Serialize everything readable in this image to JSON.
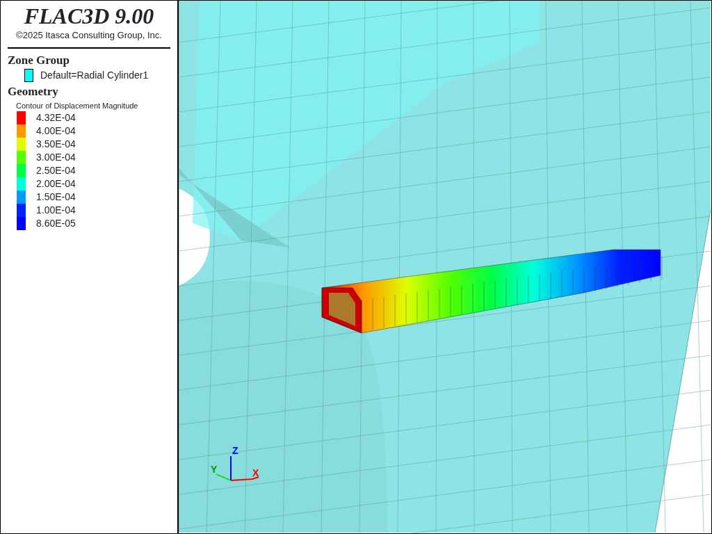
{
  "legend": {
    "title": "FLAC3D 9.00",
    "copyright": "©2025 Itasca Consulting Group, Inc.",
    "zone_group": {
      "heading": "Zone Group",
      "items": [
        {
          "label": "Default=Radial Cylinder1",
          "color": "#00ffff"
        }
      ]
    },
    "geometry": {
      "heading": "Geometry",
      "contour_title": "Contour of Displacement Magnitude",
      "entries": [
        {
          "label": "4.32E-04",
          "color": "#ff0000"
        },
        {
          "label": "4.00E-04",
          "color": "#ff9900"
        },
        {
          "label": "3.50E-04",
          "color": "#ddff00"
        },
        {
          "label": "3.00E-04",
          "color": "#55ff00"
        },
        {
          "label": "2.50E-04",
          "color": "#00ff44"
        },
        {
          "label": "2.00E-04",
          "color": "#00ffdd"
        },
        {
          "label": "1.50E-04",
          "color": "#0099ff"
        },
        {
          "label": "1.00E-04",
          "color": "#0022ff"
        },
        {
          "label": "8.60E-05",
          "color": "#0000ff"
        }
      ]
    }
  },
  "axes": [
    {
      "label": "Z",
      "color": "#0000ff"
    },
    {
      "label": "Y",
      "color": "#009900"
    },
    {
      "label": "X",
      "color": "#ff0000"
    }
  ]
}
